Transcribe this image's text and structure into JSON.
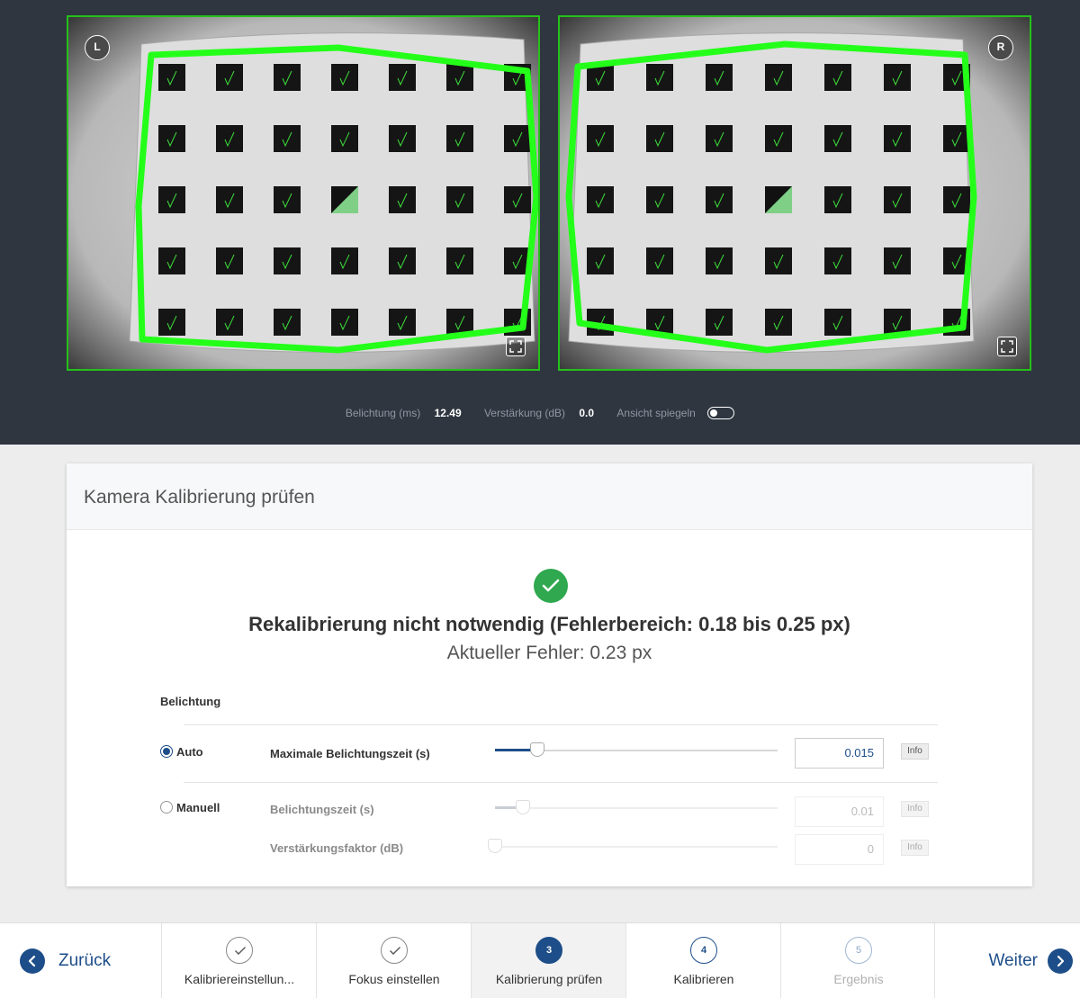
{
  "cameras": {
    "left_badge": "L",
    "right_badge": "R"
  },
  "camera_info": {
    "exposure_label": "Belichtung (ms)",
    "exposure_value": "12.49",
    "gain_label": "Verstärkung (dB)",
    "gain_value": "0.0",
    "mirror_label": "Ansicht spiegeln",
    "mirror_on": false
  },
  "card": {
    "title": "Kamera Kalibrierung prüfen",
    "status_title": "Rekalibrierung nicht notwendig (Fehlerbereich: 0.18 bis 0.25 px)",
    "status_sub": "Aktueller Fehler: 0.23 px",
    "exposure_section": "Belichtung",
    "mode_auto": "Auto",
    "mode_manual": "Manuell",
    "selected_mode": "Auto",
    "params": [
      {
        "label": "Maximale Belichtungszeit (s)",
        "value": "0.015",
        "slider_fraction": 0.15,
        "enabled": true,
        "info": "Info"
      },
      {
        "label": "Belichtungszeit (s)",
        "value": "0.01",
        "slider_fraction": 0.1,
        "enabled": false,
        "info": "Info"
      },
      {
        "label": "Verstärkungsfaktor (dB)",
        "value": "0",
        "slider_fraction": 0.0,
        "enabled": false,
        "info": "Info"
      }
    ]
  },
  "wizard": {
    "back_label": "Zurück",
    "next_label": "Weiter",
    "steps": [
      {
        "number": "",
        "label": "Kalibriereinstellun...",
        "state": "done"
      },
      {
        "number": "",
        "label": "Fokus einstellen",
        "state": "done"
      },
      {
        "number": "3",
        "label": "Kalibrierung prüfen",
        "state": "current"
      },
      {
        "number": "4",
        "label": "Kalibrieren",
        "state": "upcoming"
      },
      {
        "number": "5",
        "label": "Ergebnis",
        "state": "disabled"
      }
    ]
  },
  "colors": {
    "accent": "#1d4e89",
    "success": "#2fa84f",
    "detection": "#24ff1a",
    "dark_bg": "#2f3640"
  }
}
